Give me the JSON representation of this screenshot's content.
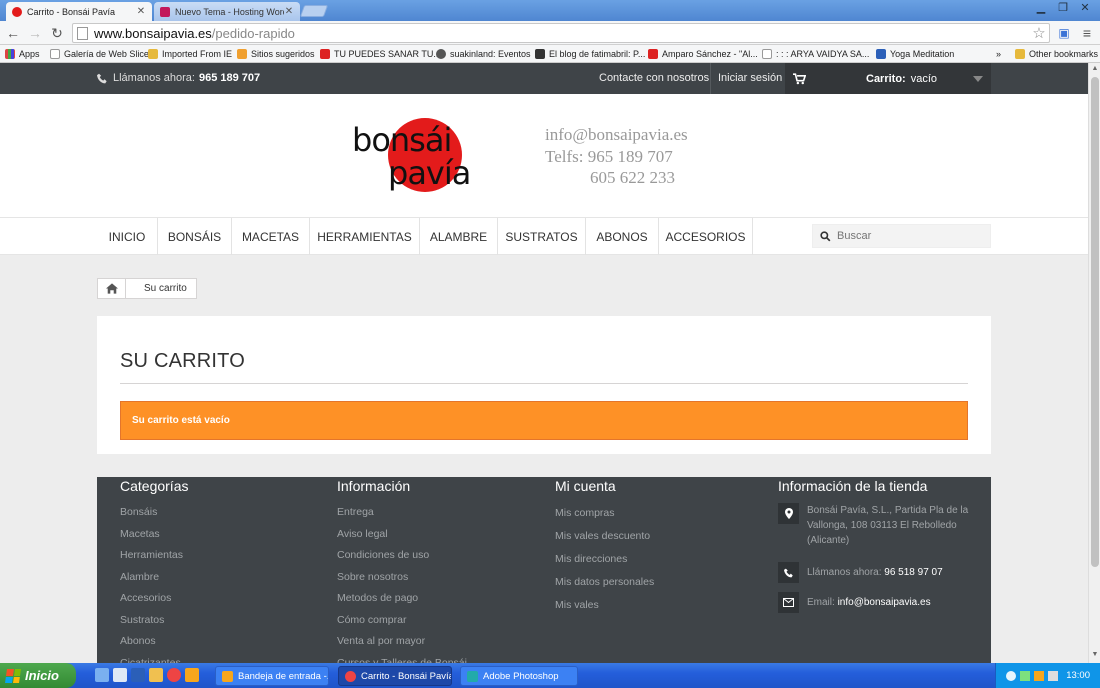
{
  "browser": {
    "tabs": [
      {
        "title": "Carrito - Bonsái Pavía",
        "active": true
      },
      {
        "title": "Nuevo Tema - Hosting Wordr",
        "active": false
      }
    ],
    "url_host": "www.bonsaipavia.es",
    "url_path": "/pedido-rapido",
    "bookmarks": [
      "Apps",
      "Galería de Web Slice",
      "Imported From IE",
      "Sitios sugeridos",
      "TU PUEDES SANAR TU...",
      "suakinland: Eventos",
      "El blog de fatimabril: P...",
      "Amparo Sánchez - \"Al...",
      ": : : ARYA VAIDYA SA...",
      "Yoga Meditation"
    ],
    "bookmarks_more": "»",
    "other_bookmarks": "Other bookmarks"
  },
  "site": {
    "topbar": {
      "phone_label": "Llámanos ahora:",
      "phone_number": "965 189 707",
      "contact": "Contacte con nosotros",
      "login": "Iniciar sesión",
      "cart_label": "Carrito:",
      "cart_value": "vacío"
    },
    "header": {
      "logo_line1": "bonsái",
      "logo_line2": "pavía",
      "email": "info@bonsaipavia.es",
      "phone1": "Telfs: 965 189 707",
      "phone2": "605 622 233"
    },
    "menu": [
      "INICIO",
      "BONSÁIS",
      "MACETAS",
      "HERRAMIENTAS",
      "ALAMBRE",
      "SUSTRATOS",
      "ABONOS",
      "ACCESORIOS"
    ],
    "search_placeholder": "Buscar",
    "breadcrumb": "Su carrito",
    "main": {
      "title": "SU CARRITO",
      "alert": "Su carrito está vacío"
    },
    "footer": {
      "categorias": {
        "title": "Categorías",
        "items": [
          "Bonsáis",
          "Macetas",
          "Herramientas",
          "Alambre",
          "Accesorios",
          "Sustratos",
          "Abonos",
          "Cicatrizantes"
        ]
      },
      "informacion": {
        "title": "Información",
        "items": [
          "Entrega",
          "Aviso legal",
          "Condiciones de uso",
          "Sobre nosotros",
          "Metodos de pago",
          "Cómo comprar",
          "Venta al por mayor",
          "Cursos y Talleres de Bonsái"
        ]
      },
      "mi_cuenta": {
        "title": "Mi cuenta",
        "items": [
          "Mis compras",
          "Mis vales descuento",
          "Mis direcciones",
          "Mis datos personales",
          "Mis vales"
        ]
      },
      "tienda": {
        "title": "Información de la tienda",
        "address": "Bonsái Pavía, S.L., Partida Pla de la Vallonga, 108 03113 El Rebolledo (Alicante)",
        "phone_label": "Llámanos ahora:",
        "phone": "96 518 97 07",
        "email_label": "Email:",
        "email": "info@bonsaipavia.es"
      }
    }
  },
  "taskbar": {
    "start": "Inicio",
    "tasks": [
      "Bandeja de entrada -...",
      "Carrito - Bonsái Pavía...",
      "Adobe Photoshop"
    ],
    "clock": "13:00"
  },
  "colors": {
    "accent_orange": "#fe9126",
    "topbar_dark": "#3f4448",
    "logo_red": "#e31b1b"
  }
}
